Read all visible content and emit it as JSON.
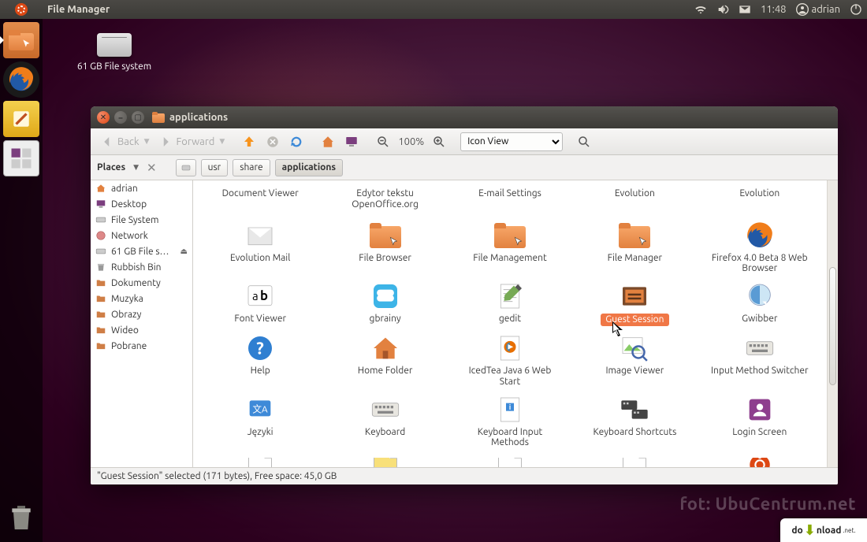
{
  "panel": {
    "app_title": "File Manager",
    "time": "11:48",
    "user": "adrian"
  },
  "desktop": {
    "drive_label": "61 GB File system"
  },
  "window": {
    "title": "applications",
    "toolbar": {
      "back": "Back",
      "forward": "Forward",
      "zoom": "100%",
      "view_mode": "Icon View"
    },
    "location": {
      "places_label": "Places",
      "crumbs": [
        "usr",
        "share",
        "applications"
      ]
    },
    "sidebar": [
      {
        "icon": "home",
        "label": "adrian"
      },
      {
        "icon": "desktop",
        "label": "Desktop"
      },
      {
        "icon": "disk",
        "label": "File System"
      },
      {
        "icon": "network",
        "label": "Network"
      },
      {
        "icon": "disk",
        "label": "61 GB File s…",
        "eject": true
      },
      {
        "icon": "trash",
        "label": "Rubbish Bin"
      },
      {
        "icon": "folder",
        "label": "Dokumenty"
      },
      {
        "icon": "folder",
        "label": "Muzyka"
      },
      {
        "icon": "folder",
        "label": "Obrazy"
      },
      {
        "icon": "folder",
        "label": "Wideo"
      },
      {
        "icon": "folder",
        "label": "Pobrane"
      }
    ],
    "apps_row_partial": [
      {
        "label": "Document Viewer",
        "icon": "blank"
      },
      {
        "label": "Edytor tekstu OpenOffice.org",
        "icon": "blank"
      },
      {
        "label": "E-mail Settings",
        "icon": "blank"
      },
      {
        "label": "Evolution",
        "icon": "blank"
      },
      {
        "label": "Evolution",
        "icon": "blank"
      }
    ],
    "apps": [
      {
        "label": "Evolution Mail",
        "icon": "mail"
      },
      {
        "label": "File Browser",
        "icon": "folder-arrow"
      },
      {
        "label": "File Management",
        "icon": "folder-arrow"
      },
      {
        "label": "File Manager",
        "icon": "folder-arrow"
      },
      {
        "label": "Firefox 4.0 Beta 8 Web Browser",
        "icon": "firefox"
      },
      {
        "label": "Font Viewer",
        "icon": "font"
      },
      {
        "label": "gbrainy",
        "icon": "gbrainy"
      },
      {
        "label": "gedit",
        "icon": "gedit"
      },
      {
        "label": "Guest Session",
        "icon": "guest",
        "selected": true
      },
      {
        "label": "Gwibber",
        "icon": "gwibber"
      },
      {
        "label": "Help",
        "icon": "help"
      },
      {
        "label": "Home Folder",
        "icon": "home-folder"
      },
      {
        "label": "IcedTea Java 6 Web Start",
        "icon": "java"
      },
      {
        "label": "Image Viewer",
        "icon": "image-viewer"
      },
      {
        "label": "Input Method Switcher",
        "icon": "keyboard"
      },
      {
        "label": "Języki",
        "icon": "languages"
      },
      {
        "label": "Keyboard",
        "icon": "keyboard"
      },
      {
        "label": "Keyboard Input Methods",
        "icon": "kim"
      },
      {
        "label": "Keyboard Shortcuts",
        "icon": "kshort"
      },
      {
        "label": "Login Screen",
        "icon": "login"
      }
    ],
    "apps_peek": [
      {
        "icon": "doc"
      },
      {
        "icon": "doc-y"
      },
      {
        "icon": "doc"
      },
      {
        "icon": "doc"
      },
      {
        "icon": "ubuntu"
      }
    ],
    "status": "\"Guest Session\" selected (171 bytes), Free space: 45,0 GB"
  },
  "watermark": "fot: UbuCentrum.net",
  "download_badge": "do    nload",
  "download_badge_mid": "↓"
}
